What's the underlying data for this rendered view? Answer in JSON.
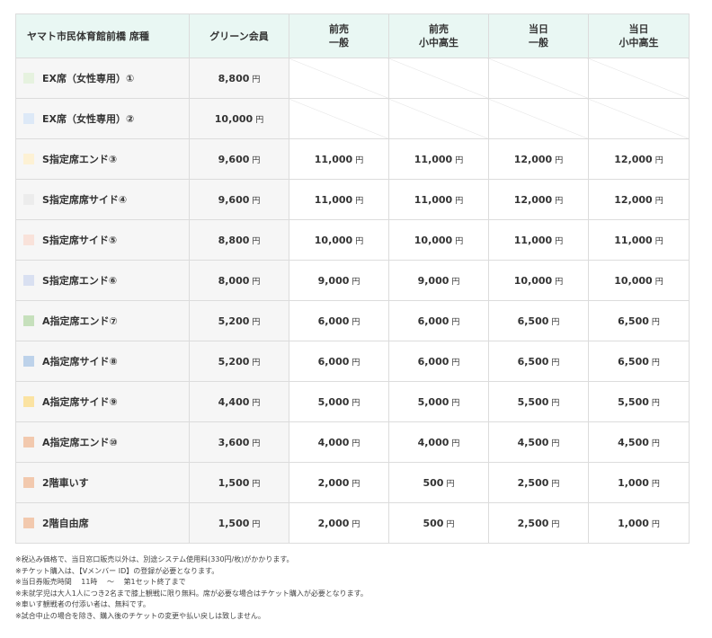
{
  "table": {
    "headers": [
      {
        "lines": [
          "ヤマト市民体育館前橋 席種"
        ]
      },
      {
        "lines": [
          "グリーン会員"
        ]
      },
      {
        "lines": [
          "前売",
          "一般"
        ]
      },
      {
        "lines": [
          "前売",
          "小中高生"
        ]
      },
      {
        "lines": [
          "当日",
          "一般"
        ]
      },
      {
        "lines": [
          "当日",
          "小中高生"
        ]
      }
    ],
    "yen_label": "円",
    "rows": [
      {
        "seat": "EX席（女性専用）①",
        "color": "#e6f2df",
        "prices": [
          "8,800",
          null,
          null,
          null,
          null
        ]
      },
      {
        "seat": "EX席（女性専用）②",
        "color": "#dde9f7",
        "prices": [
          "10,000",
          null,
          null,
          null,
          null
        ]
      },
      {
        "seat": "S指定席エンド③",
        "color": "#fdf1d4",
        "prices": [
          "9,600",
          "11,000",
          "11,000",
          "12,000",
          "12,000"
        ]
      },
      {
        "seat": "S指定席席サイド④",
        "color": "#ececec",
        "prices": [
          "9,600",
          "11,000",
          "11,000",
          "12,000",
          "12,000"
        ]
      },
      {
        "seat": "S指定席サイド⑤",
        "color": "#f9e2da",
        "prices": [
          "8,800",
          "10,000",
          "10,000",
          "11,000",
          "11,000"
        ]
      },
      {
        "seat": "S指定席エンド⑥",
        "color": "#d9e0f1",
        "prices": [
          "8,000",
          "9,000",
          "9,000",
          "10,000",
          "10,000"
        ]
      },
      {
        "seat": "A指定席エンド⑦",
        "color": "#c6e0bc",
        "prices": [
          "5,200",
          "6,000",
          "6,000",
          "6,500",
          "6,500"
        ]
      },
      {
        "seat": "A指定席サイド⑧",
        "color": "#bdd2ea",
        "prices": [
          "5,200",
          "6,000",
          "6,000",
          "6,500",
          "6,500"
        ]
      },
      {
        "seat": "A指定席サイド⑨",
        "color": "#fbe3a2",
        "prices": [
          "4,400",
          "5,000",
          "5,000",
          "5,500",
          "5,500"
        ]
      },
      {
        "seat": "A指定席エンド⑩",
        "color": "#f2c9ae",
        "prices": [
          "3,600",
          "4,000",
          "4,000",
          "4,500",
          "4,500"
        ]
      },
      {
        "seat": "2階車いす",
        "color": "#f2c9ae",
        "prices": [
          "1,500",
          "2,000",
          "500",
          "2,500",
          "1,000"
        ]
      },
      {
        "seat": "2階自由席",
        "color": "#f2c9ae",
        "prices": [
          "1,500",
          "2,000",
          "500",
          "2,500",
          "1,000"
        ]
      }
    ]
  },
  "notes": [
    "※税込み価格で、当日窓口販売以外は、別途システム使用料(330円/枚)がかかります。",
    "※チケット購入は、【Vメンバー ID】の登録が必要となります。",
    "※当日券販売時間　 11時　 〜　 第1セット終了まで",
    "※未就学児は大人1人につき2名まで膝上観戦に限り無料。席が必要な場合はチケット購入が必要となります。",
    "※車いす観戦者の付添い者は、無料です。",
    "※試合中止の場合を除き、購入後のチケットの変更や払い戻しは致しません。"
  ]
}
